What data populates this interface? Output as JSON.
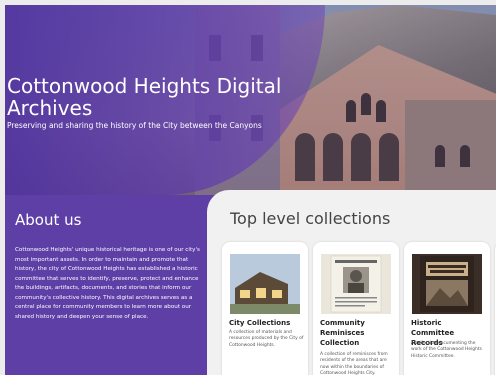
{
  "hero": {
    "title": "Cottonwood Heights Digital Archives",
    "subtitle": "Preserving and sharing the history of the City between the Canyons"
  },
  "about": {
    "heading": "About us",
    "body": "Cottonwood Heights' unique historical heritage is one of our city's most important assets. In order to maintain and promote that history, the city of Cottonwood Heights has established a historic committee that serves to identify, preserve, protect and enhance the buildings, artifacts, documents, and stories that inform our community's collective history. This digital archives serves as a central place for community members to learn more about our shared history and deepen your sense of place."
  },
  "collections": {
    "heading": "Top level collections",
    "items": [
      {
        "title": "City Collections",
        "description": "A collection of materials and resources produced by the City of Cottonwood Heights.",
        "icon": "house-photo-thumbnail"
      },
      {
        "title": "Community Reminisces Collection",
        "description": "A collection of reminisces from residents of the areas that are now within the boundaries of Cottonwood Heights City.",
        "icon": "newspaper-portrait-thumbnail"
      },
      {
        "title": "Historic Committee Records",
        "description": "A collection documenting the work of the Cottonwood Heights Historic Committee.",
        "icon": "canyons-book-cover-thumbnail"
      }
    ]
  },
  "colors": {
    "brand_purple": "#5e3fa6",
    "panel_bg": "#f1f1f1",
    "card_bg": "#ffffff"
  }
}
